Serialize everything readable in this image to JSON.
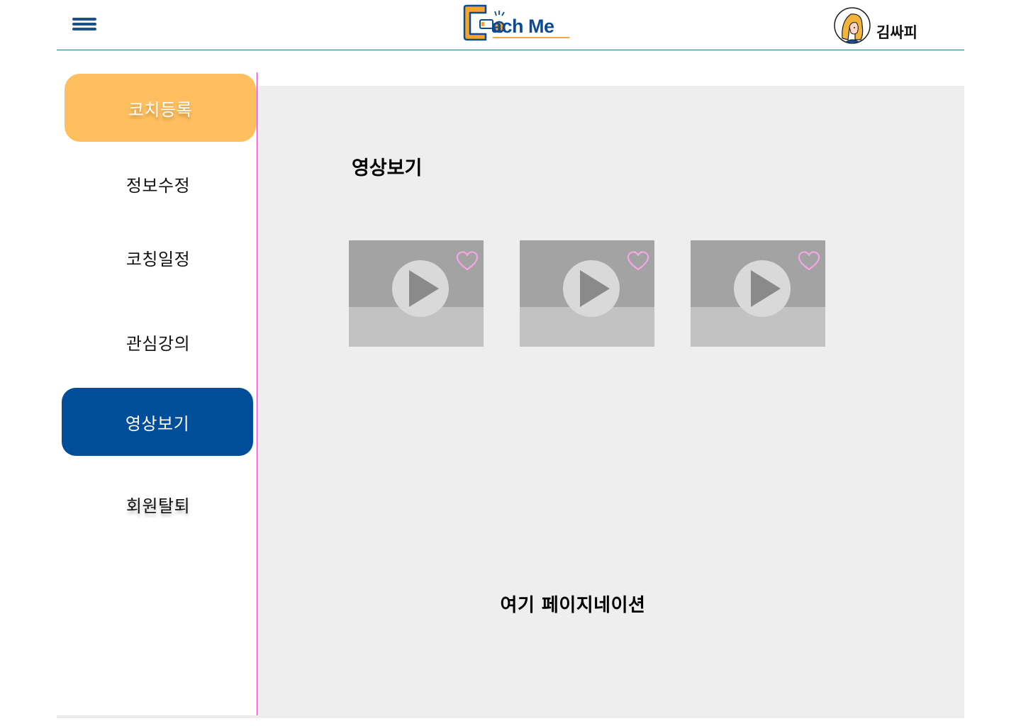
{
  "app": {
    "logo_text": "ach Me",
    "logo_text_full": "Coach Me",
    "colors": {
      "brand_blue": "#004d99",
      "brand_orange": "#ffbf5e",
      "divider_pink": "#d23fc9",
      "heart_pink": "#f6a6e8"
    }
  },
  "header": {
    "menu_icon": "hamburger-icon",
    "user": {
      "name": "김싸피",
      "avatar_icon": "avatar-icon"
    }
  },
  "sidebar": {
    "items": [
      {
        "label": "코치등록",
        "style": "orange-button"
      },
      {
        "label": "정보수정",
        "style": "plain"
      },
      {
        "label": "코칭일정",
        "style": "plain"
      },
      {
        "label": "관심강의",
        "style": "plain"
      },
      {
        "label": "영상보기",
        "style": "selected-blue"
      },
      {
        "label": "회원탈퇴",
        "style": "plain"
      }
    ]
  },
  "main": {
    "title": "영상보기",
    "videos": [
      {
        "play_icon": "play-icon",
        "favorite_icon": "heart-icon"
      },
      {
        "play_icon": "play-icon",
        "favorite_icon": "heart-icon"
      },
      {
        "play_icon": "play-icon",
        "favorite_icon": "heart-icon"
      }
    ],
    "pagination_text": "여기 페이지네이션"
  }
}
